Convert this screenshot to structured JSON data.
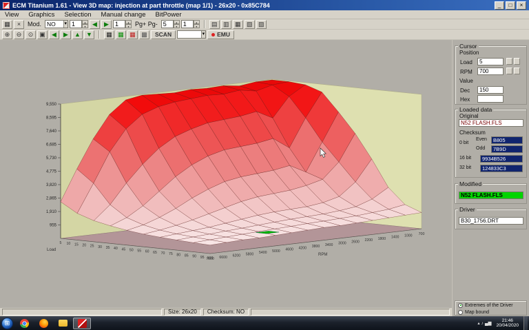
{
  "window": {
    "title": "ECM Titanium 1.61 - View 3D map: injection at part throttle (map 1/1) - 26x20 - 0x85C784",
    "controls": {
      "minimize": "_",
      "maximize": "□",
      "close": "×"
    }
  },
  "menu": {
    "items": [
      "View",
      "Graphics",
      "Selection",
      "Manual change",
      "BitPower"
    ]
  },
  "toolbar1": {
    "icons_left": [
      {
        "name": "grid-view-icon",
        "glyph": "▦"
      },
      {
        "name": "close-map-icon",
        "glyph": "×"
      }
    ],
    "mod_label": "Mod.",
    "mod_value": "NO",
    "row_step_value": "1",
    "nav_icons": [
      {
        "name": "prev-map-icon",
        "glyph": "◀",
        "color": "#0b7d0b"
      },
      {
        "name": "next-map-icon",
        "glyph": "▶",
        "color": "#0b7d0b"
      }
    ],
    "col_step_value": "1",
    "pg_label": "Pg+  Pg-",
    "pg_plus_value": "5",
    "pg_minus_value": "1",
    "icons_right": [
      {
        "name": "select-row-icon",
        "glyph": "▤"
      },
      {
        "name": "select-column-icon",
        "glyph": "▥"
      },
      {
        "name": "select-all-icon",
        "glyph": "▦"
      },
      {
        "name": "interpolate-icon",
        "glyph": "▧"
      },
      {
        "name": "smooth-icon",
        "glyph": "▨"
      }
    ]
  },
  "toolbar2": {
    "zoom_icons": [
      {
        "name": "zoom-in-icon",
        "glyph": "⊕"
      },
      {
        "name": "zoom-out-icon",
        "glyph": "⊖"
      },
      {
        "name": "zoom-window-icon",
        "glyph": "⊙"
      },
      {
        "name": "zoom-fit-icon",
        "glyph": "▣"
      }
    ],
    "nav_icons": [
      {
        "name": "rotate-left-icon",
        "glyph": "◀",
        "color": "#0b7d0b"
      },
      {
        "name": "rotate-right-icon",
        "glyph": "▶",
        "color": "#0b7d0b"
      },
      {
        "name": "rotate-up-icon",
        "glyph": "▲",
        "color": "#0b7d0b"
      },
      {
        "name": "rotate-down-icon",
        "glyph": "▼",
        "color": "#0b7d0b"
      }
    ],
    "map_icons": [
      {
        "name": "map-original-icon",
        "glyph": "▦",
        "color": "#222222"
      },
      {
        "name": "map-modified-icon",
        "glyph": "▦",
        "color": "#0a8f0a"
      },
      {
        "name": "map-diff-icon",
        "glyph": "▦",
        "color": "#c02020"
      },
      {
        "name": "map-overlay-icon",
        "glyph": "▩",
        "color": "#555555"
      }
    ],
    "scan_label": "SCAN",
    "scan_combo_value": "",
    "emu_label": "EMU"
  },
  "cursor_panel": {
    "title": "Cursor",
    "position_label": "Position",
    "load_label": "Load",
    "load_value": "5",
    "rpm_label": "RPM",
    "rpm_value": "700",
    "value_label": "Value",
    "dec_label": "Dec",
    "dec_value": "150",
    "hex_label": "Hex",
    "hex_value": ""
  },
  "loaded_panel": {
    "title": "Loaded data",
    "original_label": "Original",
    "original_value": "N52 FLASH.FLS",
    "checksum_label": "Checksum",
    "bit0_label": "0 bit",
    "even_label": "Even",
    "even_value": "B805",
    "odd_label": "Odd",
    "odd_value": "7B9D",
    "bit16_label": "16 bit",
    "bit16_value": "9934B526",
    "bit32_label": "32 bit",
    "bit32_value": "124833C3"
  },
  "modified_panel": {
    "title": "Modified",
    "value": "N52 FLASH.FLS"
  },
  "driver_panel": {
    "title": "Driver",
    "value": "B30_1756.DRT"
  },
  "view_options": {
    "items": [
      {
        "label": "Extremes of the Driver",
        "selected": true
      },
      {
        "label": "Map bound",
        "selected": false
      }
    ]
  },
  "statusbar": {
    "size": "Size: 26x20",
    "checksum": "Checksum: NO"
  },
  "taskbar": {
    "time": "21:46",
    "date": "20/04/2020",
    "apps": [
      {
        "name": "chrome",
        "active": false
      },
      {
        "name": "firefox",
        "active": false
      },
      {
        "name": "explorer",
        "active": false
      },
      {
        "name": "ecm",
        "active": true
      }
    ],
    "tray_icons": [
      {
        "name": "hidden-icons-icon",
        "glyph": "▴"
      },
      {
        "name": "volume-icon",
        "glyph": "♪"
      },
      {
        "name": "network-icon",
        "glyph": "▄▆"
      }
    ]
  },
  "chart_data": {
    "type": "surface3d",
    "title": "injection at part throttle",
    "z_max": 9550,
    "z_ticks": [
      "955",
      "1,910",
      "2,865",
      "3,820",
      "4,775",
      "5,730",
      "6,685",
      "7,640",
      "8,595",
      "9,550"
    ],
    "load_axis_title": "Load",
    "rpm_axis_title": "RPM",
    "load_labels": [
      "5",
      "10",
      "15",
      "20",
      "25",
      "30",
      "35",
      "40",
      "45",
      "50",
      "55",
      "60",
      "65",
      "70",
      "75",
      "80",
      "85",
      "90",
      "95",
      "100"
    ],
    "rpm_labels": [
      "7000",
      "6600",
      "6200",
      "5800",
      "5400",
      "5000",
      "4600",
      "4200",
      "3800",
      "3400",
      "3000",
      "2600",
      "2200",
      "1800",
      "1400",
      "1000",
      "700"
    ],
    "marker_color": "#00b400",
    "z_grid": [
      [
        600,
        650,
        700,
        700,
        750,
        800,
        850,
        900,
        900,
        950,
        1000,
        1050,
        1100,
        1150
      ],
      [
        650,
        720,
        780,
        840,
        900,
        950,
        1000,
        1060,
        1100,
        1150,
        1200,
        1300,
        1400,
        1600
      ],
      [
        720,
        800,
        870,
        950,
        1020,
        1100,
        1180,
        1250,
        1300,
        1350,
        1450,
        1600,
        2000,
        2700
      ],
      [
        800,
        900,
        1000,
        1100,
        1250,
        1400,
        1550,
        1650,
        1700,
        1750,
        1900,
        2200,
        3100,
        4600
      ],
      [
        900,
        1050,
        1250,
        1500,
        1800,
        2100,
        2400,
        2600,
        2700,
        2800,
        3000,
        3300,
        4400,
        6300
      ],
      [
        1050,
        1300,
        1700,
        2200,
        2800,
        3300,
        3700,
        3900,
        4000,
        4100,
        4300,
        3700,
        5700,
        7700
      ],
      [
        1250,
        1700,
        2400,
        3300,
        4200,
        4900,
        5400,
        5700,
        5800,
        5900,
        6100,
        5300,
        7300,
        9000
      ],
      [
        1500,
        2500,
        3900,
        5100,
        6100,
        6800,
        7200,
        7500,
        7600,
        7700,
        7900,
        7300,
        8700,
        9400
      ],
      [
        1900,
        3900,
        6000,
        7500,
        8400,
        8800,
        9000,
        9100,
        9200,
        9150,
        9300,
        9100,
        9400,
        9500
      ],
      [
        2600,
        4800,
        6800,
        8400,
        9300,
        9500,
        9450,
        9400,
        9500,
        9450,
        9500,
        9350,
        9500,
        9500
      ]
    ]
  }
}
